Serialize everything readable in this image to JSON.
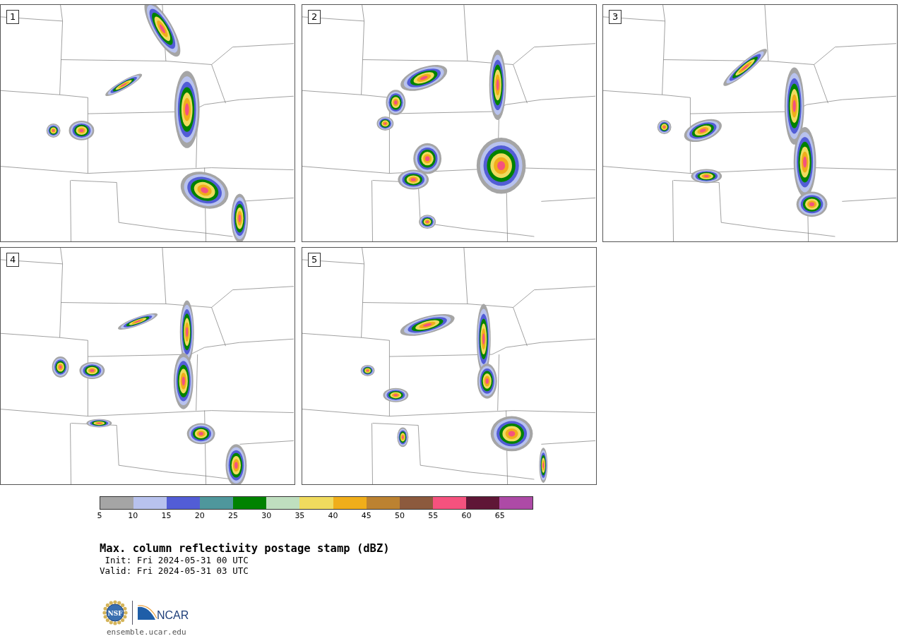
{
  "panels": [
    {
      "label": "1"
    },
    {
      "label": "2"
    },
    {
      "label": "3"
    },
    {
      "label": "4"
    },
    {
      "label": "5"
    }
  ],
  "colorbar": {
    "bins": [
      {
        "color": "#a5a5a5"
      },
      {
        "color": "#b8c2ee"
      },
      {
        "color": "#525dd6"
      },
      {
        "color": "#4f979c"
      },
      {
        "color": "#008200"
      },
      {
        "color": "#bfdfbf"
      },
      {
        "color": "#f0db5e"
      },
      {
        "color": "#f0ae1a"
      },
      {
        "color": "#bc8231"
      },
      {
        "color": "#8c5a3d"
      },
      {
        "color": "#f5527e"
      },
      {
        "color": "#5f1636"
      },
      {
        "color": "#ad4aa6"
      }
    ],
    "ticks": [
      "5",
      "10",
      "15",
      "20",
      "25",
      "30",
      "35",
      "40",
      "45",
      "50",
      "55",
      "60",
      "65"
    ]
  },
  "title": "Max. column reflectivity postage stamp (dBZ)",
  "init": " Init: Fri 2024-05-31 00 UTC",
  "valid": "Valid: Fri 2024-05-31 03 UTC",
  "logos": {
    "nsf": "NSF",
    "ncar": "NCAR"
  },
  "url": "ensemble.ucar.edu"
}
